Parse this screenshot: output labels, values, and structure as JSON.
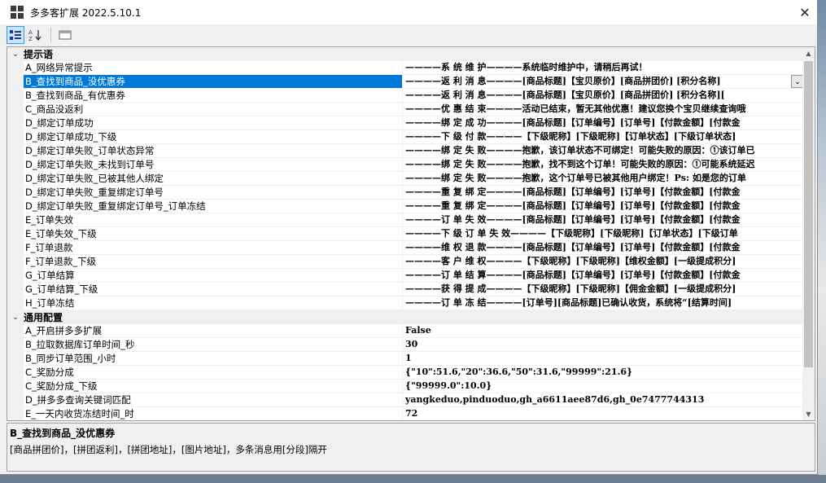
{
  "window": {
    "title": "多多客扩展 2022.5.10.1",
    "close_glyph": "✕"
  },
  "toolbar": {
    "categorized_label": "分类",
    "alphabetical_label": "A↓Z",
    "property_pages_label": "属性页"
  },
  "categories": [
    {
      "name": "提示语",
      "rows": [
        {
          "name": "A_网络异常提示",
          "value": "————系 统 维 护————系统临时维护中，请稍后再试！"
        },
        {
          "name": "B_查找到商品_没优惠券",
          "value": "————返 利 消 息————[商品标题]【宝贝原价】[商品拼团价] [积分名称]",
          "selected": true
        },
        {
          "name": "B_查找到商品_有优惠券",
          "value": "————返 利 消 息————[商品标题]【宝贝原价】[商品拼团价] [积分名称]["
        },
        {
          "name": "C_商品没返利",
          "value": "————优 惠 结 束————活动已结束，暂无其他优惠！建议您换个宝贝继续查询哦"
        },
        {
          "name": "D_绑定订单成功",
          "value": "————绑 定 成 功————[商品标题]【订单编号】[订单号]【付款金额】[付款金"
        },
        {
          "name": "D_绑定订单成功_下级",
          "value": "————下 级 付 款————【下级昵称】[下级昵称]【订单状态】[下级订单状态]"
        },
        {
          "name": "D_绑定订单失败_订单状态异常",
          "value": "————绑 定 失 败————抱歉，该订单状态不可绑定！可能失败的原因：①该订单已"
        },
        {
          "name": "D_绑定订单失败_未找到订单号",
          "value": "————绑 定 失 败————抱歉，找不到这个订单！可能失败的原因：①可能系统延迟"
        },
        {
          "name": "D_绑定订单失败_已被其他人绑定",
          "value": "————绑 定 失 败————抱歉，这个订单号已被其他用户绑定！Ps: 如是您的订单"
        },
        {
          "name": "D_绑定订单失败_重复绑定订单号",
          "value": "————重 复 绑 定————[商品标题]【订单编号】[订单号]【付款金额】[付款金"
        },
        {
          "name": "D_绑定订单失败_重复绑定订单号_订单冻结",
          "value": "————重 复 绑 定————[商品标题]【订单编号】[订单号]【付款金额】[付款金"
        },
        {
          "name": "E_订单失效",
          "value": "————订 单 失 效————[商品标题]【订单编号】[订单号]【付款金额】[付款金"
        },
        {
          "name": "E_订单失效_下级",
          "value": "————下 级 订 单 失 效————【下级昵称】[下级昵称]【订单状态】[下级订单"
        },
        {
          "name": "F_订单退款",
          "value": "————维 权 退 款————[商品标题]【订单编号】[订单号]【付款金额】[付款金"
        },
        {
          "name": "F_订单退款_下级",
          "value": "————客 户 维 权————【下级昵称】[下级昵称]【维权金额】[一级提成积分]"
        },
        {
          "name": "G_订单结算",
          "value": "————订 单 结 算————[商品标题]【订单编号】[订单号]【付款金额】[付款金"
        },
        {
          "name": "G_订单结算_下级",
          "value": "————获 得 提 成————【下级昵称】[下级昵称]【佣金金额】[一级提成积分]"
        },
        {
          "name": "H_订单冻结",
          "value": "————订 单 冻 结————[订单号][商品标题]已确认收货，系统将“[结算时间]"
        }
      ]
    },
    {
      "name": "通用配置",
      "rows": [
        {
          "name": "A_开启拼多多扩展",
          "value": "False"
        },
        {
          "name": "B_拉取数据库订单时间_秒",
          "value": "30"
        },
        {
          "name": "B_同步订单范围_小时",
          "value": "1"
        },
        {
          "name": "C_奖励分成",
          "value": "{\"10\":51.6,\"20\":36.6,\"50\":31.6,\"99999\":21.6}"
        },
        {
          "name": "C_奖励分成_下级",
          "value": "{\"99999.0\":10.0}"
        },
        {
          "name": "D_拼多多查询关键词匹配",
          "value": "yangkeduo,pinduoduo,gh_a6611aee87d6,gh_0e7477744313"
        },
        {
          "name": "E_一天内收货冻结时间_时",
          "value": "72"
        }
      ]
    }
  ],
  "help": {
    "title": "B_查找到商品_没优惠券",
    "description": "[商品拼团价]，[拼团返利]，[拼团地址]，[图片地址]，多条消息用[分段]隔开"
  },
  "scroll": {
    "up_glyph": "▲",
    "down_glyph": "▼"
  },
  "icons": {
    "expand_glyph": "⌄",
    "dropdown_glyph": "⌄"
  }
}
